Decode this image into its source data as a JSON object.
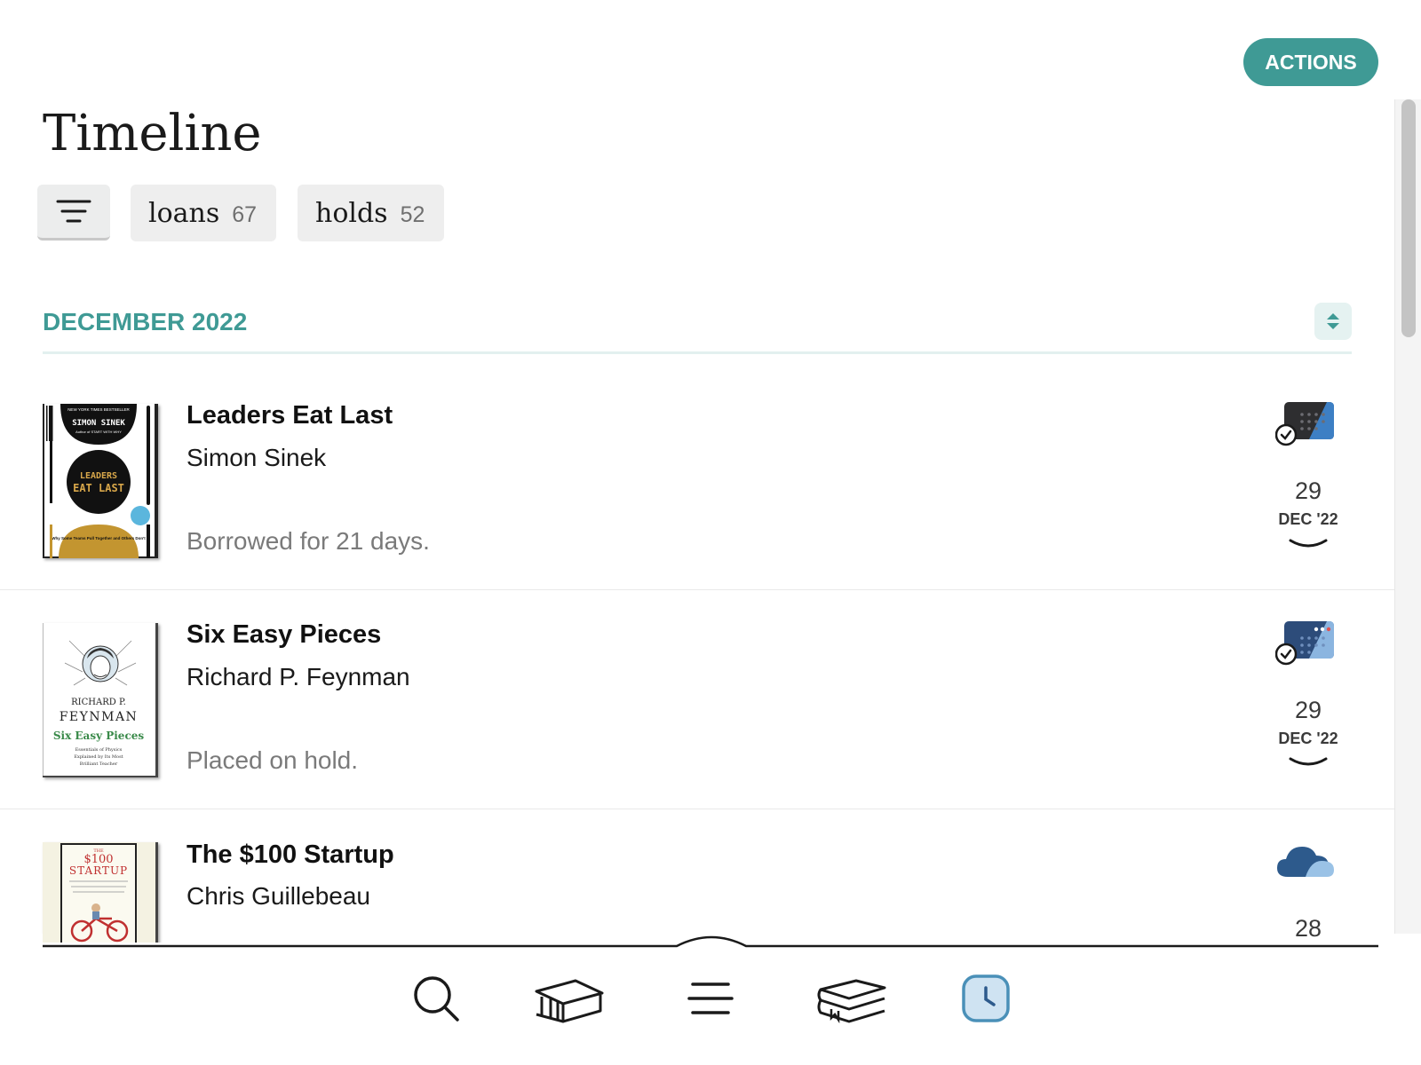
{
  "header": {
    "actions_label": "ACTIONS",
    "title": "Timeline"
  },
  "filters": {
    "filter_icon": "filter-lines-icon",
    "loans": {
      "label": "loans",
      "count": "67"
    },
    "holds": {
      "label": "holds",
      "count": "52"
    }
  },
  "month": {
    "label": "DECEMBER 2022",
    "toggle_icon": "collapse-expand-icon"
  },
  "timeline": [
    {
      "title": "Leaders Eat Last",
      "author": "Simon Sinek",
      "note": "Borrowed for 21 days.",
      "event_icon": "calendar-loan-icon",
      "day": "29",
      "month": "DEC '22",
      "cover": {
        "top": "NEW YORK TIMES BESTSELLER",
        "author": "SIMON SINEK",
        "sub": "Author of START WITH WHY",
        "t1": "LEADERS",
        "t2": "EAT LAST",
        "tag": "Why Some Teams Pull Together and Others Don't"
      }
    },
    {
      "title": "Six Easy Pieces",
      "author": "Richard P. Feynman",
      "note": "Placed on hold.",
      "event_icon": "calendar-hold-icon",
      "day": "29",
      "month": "DEC '22",
      "cover": {
        "a1": "RICHARD P.",
        "a2": "FEYNMAN",
        "t": "Six Easy Pieces",
        "s1": "Essentials of Physics",
        "s2": "Explained by Its Most",
        "s3": "Brilliant Teacher"
      }
    },
    {
      "title": "The $100 Startup",
      "author": "Chris Guillebeau",
      "event_icon": "cloud-icon",
      "day": "28",
      "cover": {
        "t1": "THE",
        "t2": "$100",
        "t3": "STARTUP"
      }
    }
  ],
  "colors": {
    "accent": "#3f9a95",
    "accent_light": "#e5f2f1",
    "nav_active": "#4a90b8"
  },
  "nav": [
    {
      "icon": "search-icon",
      "active": false
    },
    {
      "icon": "library-icon",
      "active": false
    },
    {
      "icon": "menu-icon",
      "active": false
    },
    {
      "icon": "bookshelf-icon",
      "active": false
    },
    {
      "icon": "clock-icon",
      "active": true
    }
  ]
}
